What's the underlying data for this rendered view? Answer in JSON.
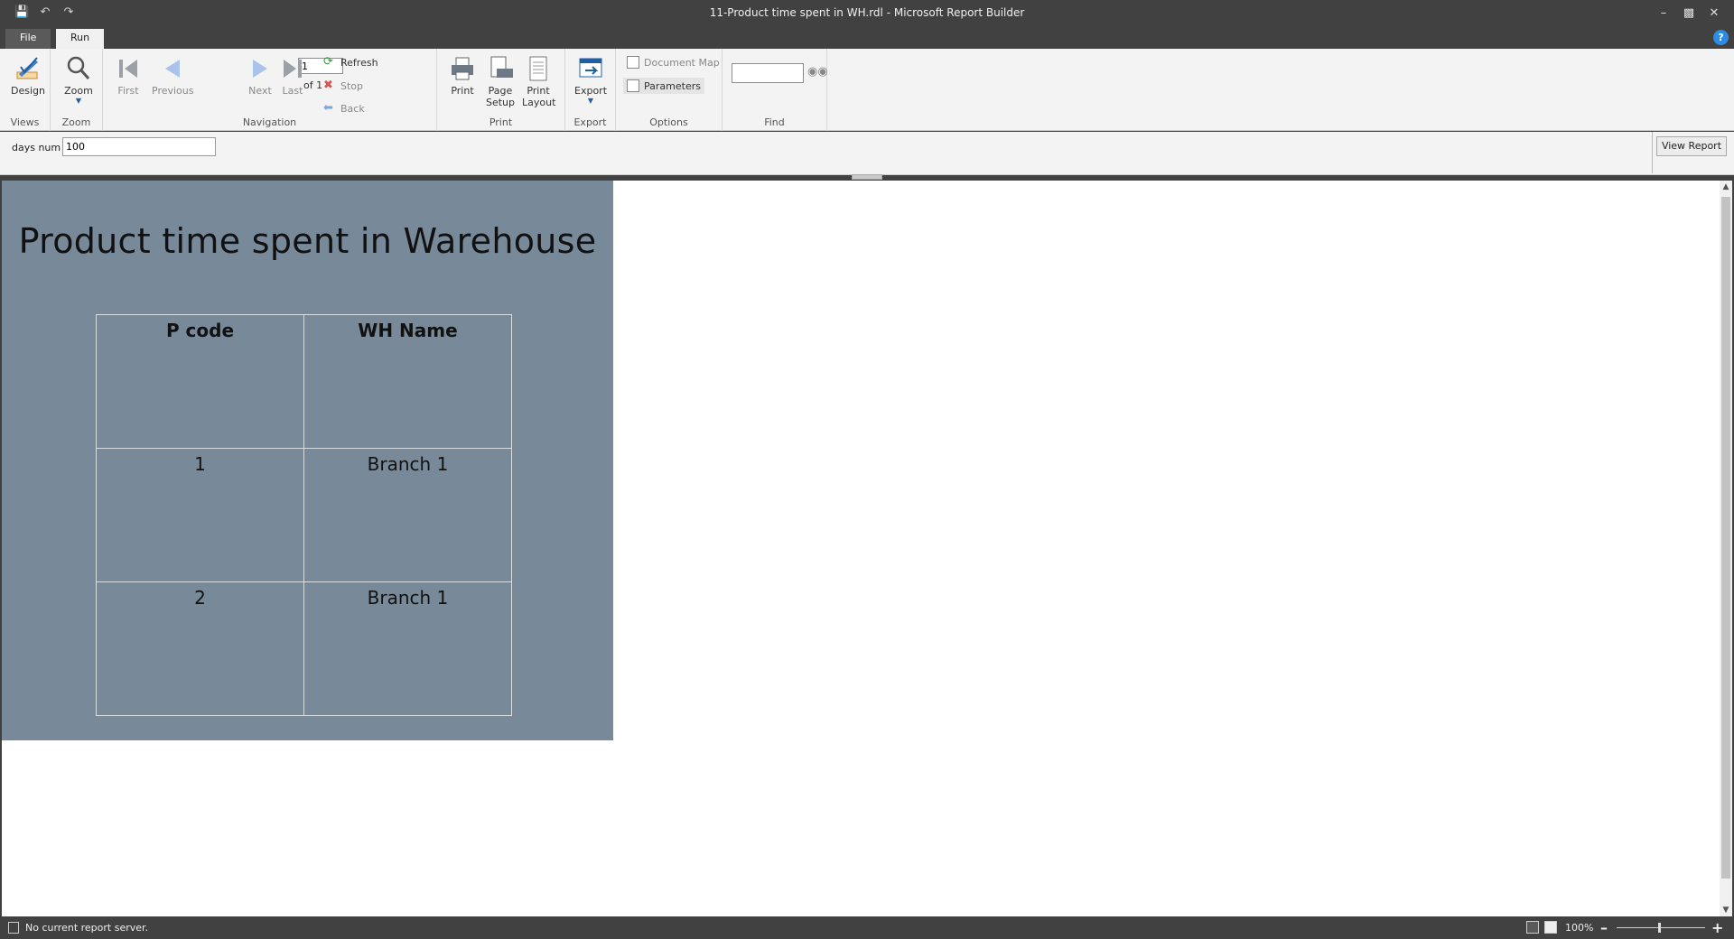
{
  "window": {
    "title": "11-Product time spent in WH.rdl - Microsoft Report Builder"
  },
  "tabs": {
    "file": "File",
    "run": "Run"
  },
  "ribbon": {
    "views": {
      "design": "Design",
      "group": "Views"
    },
    "zoom": {
      "zoom": "Zoom",
      "group": "Zoom"
    },
    "navigation": {
      "first": "First",
      "previous": "Previous",
      "page_value": "1",
      "of_label": "of  1",
      "next": "Next",
      "last": "Last",
      "refresh": "Refresh",
      "stop": "Stop",
      "back": "Back",
      "group": "Navigation"
    },
    "print": {
      "print": "Print",
      "page_setup": "Page Setup",
      "print_layout": "Print Layout",
      "group": "Print"
    },
    "export": {
      "export": "Export",
      "group": "Export"
    },
    "options": {
      "document_map": "Document Map",
      "parameters": "Parameters",
      "group": "Options"
    },
    "find": {
      "group": "Find"
    }
  },
  "parameters": {
    "label": "days num",
    "value": "100",
    "view_report": "View Report"
  },
  "report": {
    "title": "Product time spent in Warehouse",
    "columns": [
      "P code",
      "WH Name"
    ],
    "rows": [
      [
        "1",
        "Branch 1"
      ],
      [
        "2",
        "Branch 1"
      ]
    ]
  },
  "status": {
    "text": "No current report server.",
    "zoom": "100%"
  },
  "colors": {
    "page_bg": "#788a9a",
    "chrome": "#414141",
    "ribbon": "#f3f3f3"
  }
}
